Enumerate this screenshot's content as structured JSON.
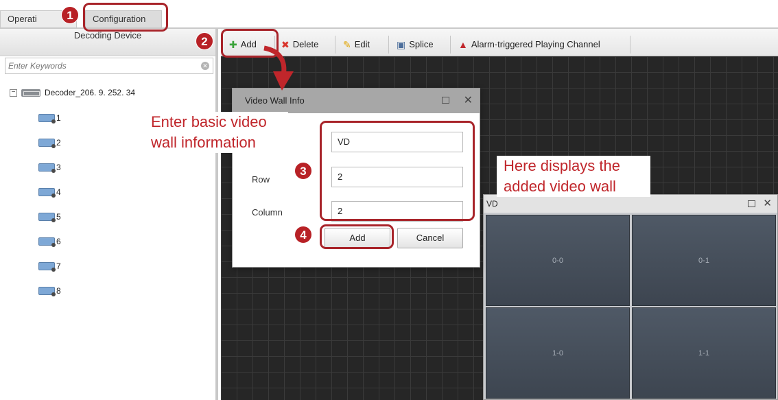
{
  "tabs": {
    "operation": "Operati",
    "configuration": "Configuration"
  },
  "left_panel": {
    "title": "Decoding Device",
    "search_placeholder": "Enter Keywords",
    "root": "Decoder_206. 9. 252. 34",
    "channels": [
      "1",
      "2",
      "3",
      "4",
      "5",
      "6",
      "7",
      "8"
    ]
  },
  "toolbar": {
    "add": "Add",
    "delete": "Delete",
    "edit": "Edit",
    "splice": "Splice",
    "alarm": "Alarm-triggered Playing Channel"
  },
  "dialog": {
    "title": "Video Wall Info",
    "name_value": "VD",
    "row_label": "Row",
    "row_value": "2",
    "column_label": "Column",
    "column_value": "2",
    "add_button": "Add",
    "cancel_button": "Cancel"
  },
  "video_wall": {
    "title": "VD",
    "cells": [
      "0-0",
      "0-1",
      "1-0",
      "1-1"
    ]
  },
  "annotations": {
    "steps": [
      "1",
      "2",
      "3",
      "4"
    ],
    "note_left": [
      "Enter basic video",
      "wall information"
    ],
    "note_right": [
      "Here displays the",
      "added video wall"
    ],
    "color": "#b82126"
  }
}
